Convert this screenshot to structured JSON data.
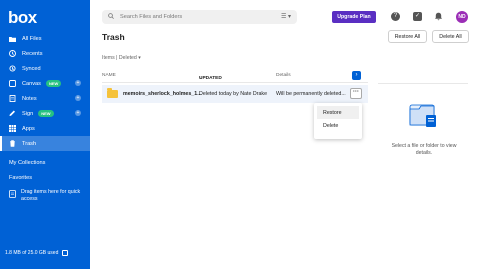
{
  "brand": {
    "logo": "box"
  },
  "sidebar": {
    "items": [
      {
        "label": "All Files",
        "icon": "folder-icon"
      },
      {
        "label": "Recents",
        "icon": "clock-icon"
      },
      {
        "label": "Synced",
        "icon": "sync-icon"
      },
      {
        "label": "Canvas",
        "icon": "canvas-icon",
        "badge": "NEW",
        "plus": true
      },
      {
        "label": "Notes",
        "icon": "notes-icon",
        "plus": true
      },
      {
        "label": "Sign",
        "icon": "sign-icon",
        "badge": "NEW",
        "plus": true
      },
      {
        "label": "Apps",
        "icon": "apps-grid-icon"
      },
      {
        "label": "Trash",
        "icon": "trash-icon",
        "active": true
      }
    ],
    "sections": {
      "my_collections": "My Collections",
      "favorites": "Favorites"
    },
    "drag_hint": "Drag items here for quick access",
    "storage": "1.8 MB of 25.0 GB used"
  },
  "topbar": {
    "search_placeholder": "Search Files and Folders",
    "upgrade_label": "Upgrade Plan",
    "avatar_initials": "ND"
  },
  "page": {
    "title": "Trash",
    "restore_all": "Restore All",
    "delete_all": "Delete All",
    "items_count": "Items | Deleted"
  },
  "table": {
    "columns": {
      "name": "NAME",
      "updated": "UPDATED",
      "details": "Details"
    },
    "rows": [
      {
        "name": "memoirs_sherlock_holmes_1...",
        "updated": "Deleted today by Nate Drake",
        "details": "Will be permanently deleted..."
      }
    ]
  },
  "context_menu": {
    "items": [
      "Restore",
      "Delete"
    ]
  },
  "right_panel": {
    "empty_text": "Select a file or folder to view details."
  },
  "colors": {
    "sidebar": "#0061d5",
    "upgrade": "#5a2fc2",
    "avatar": "#9b2eb6",
    "folder": "#f5c23a",
    "badge": "#26c281"
  }
}
